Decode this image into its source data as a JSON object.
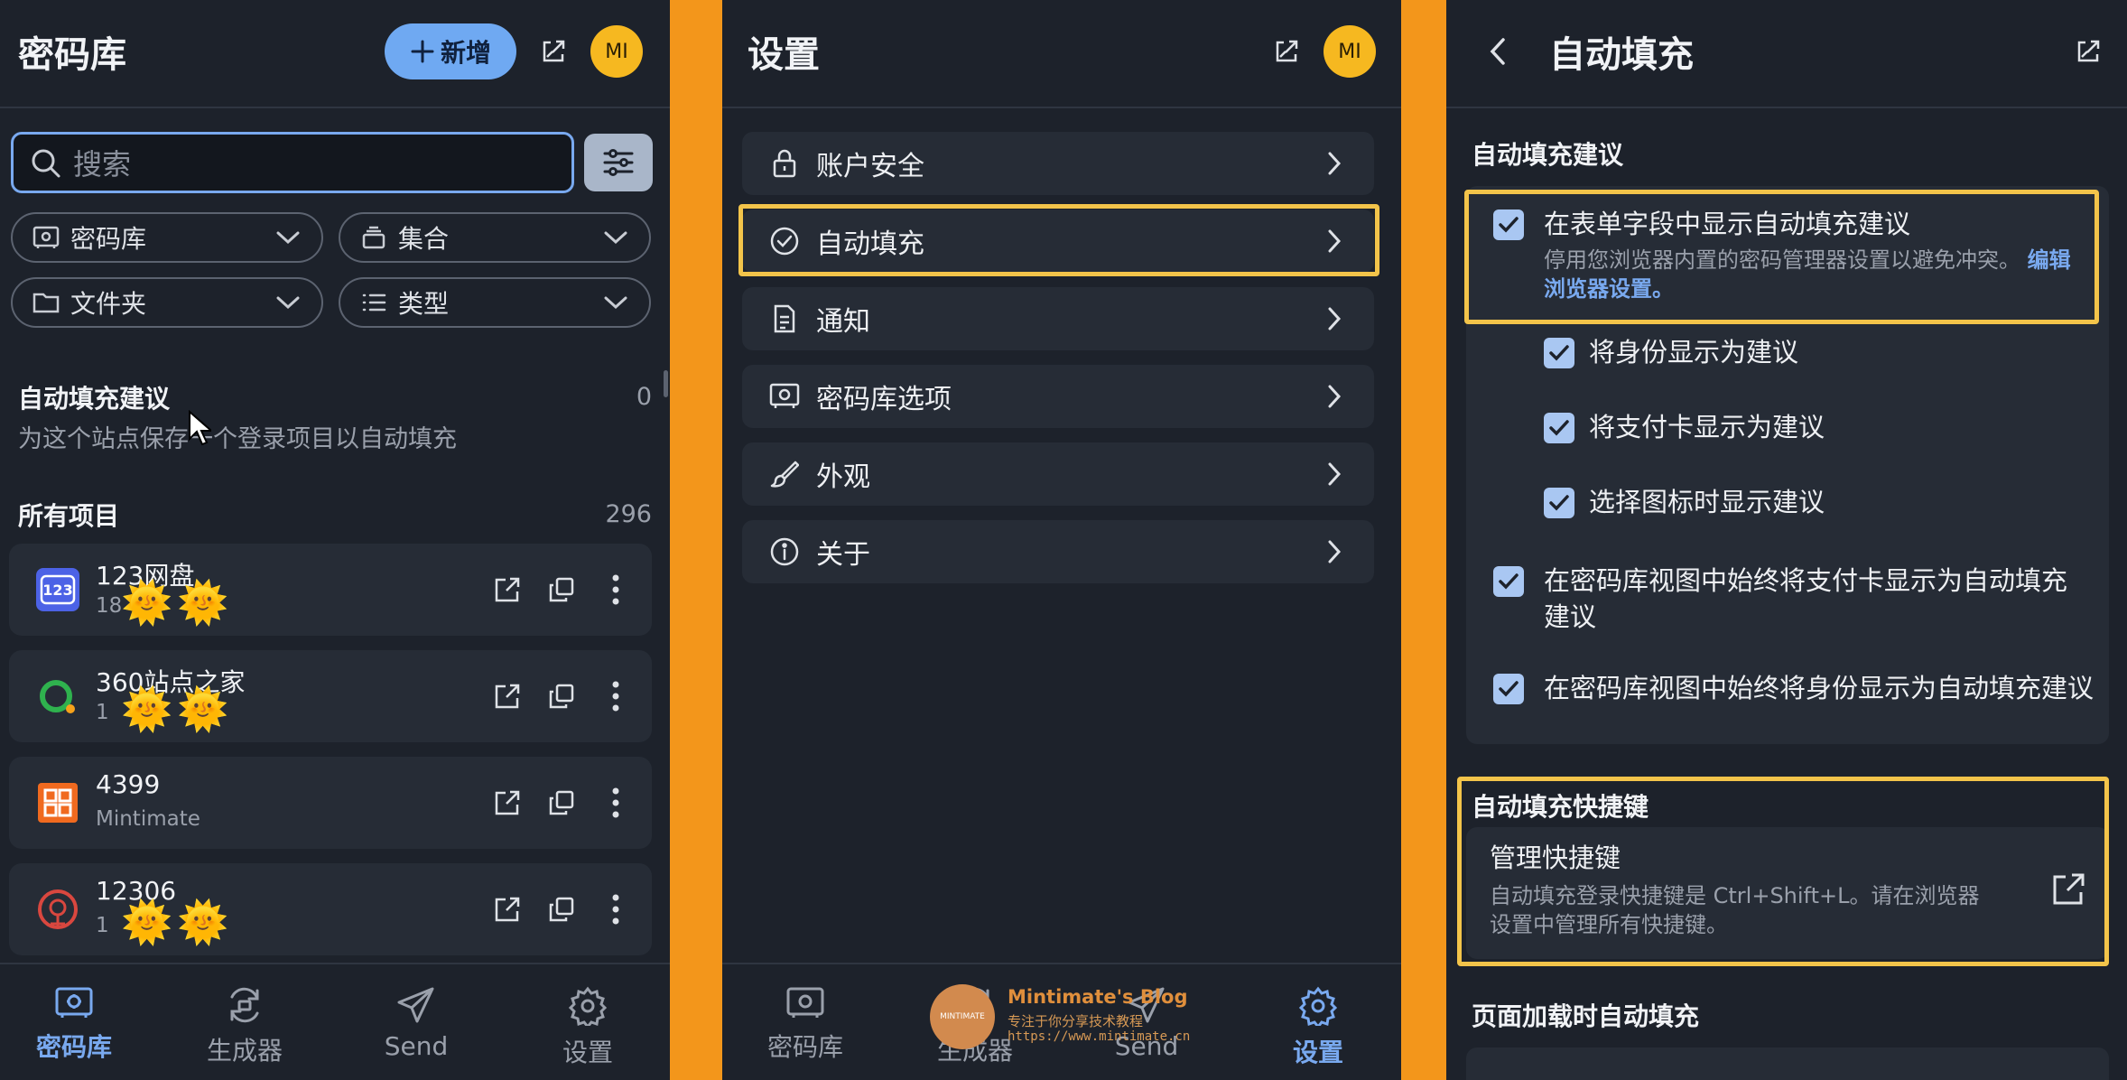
{
  "vault_panel": {
    "title": "密码库",
    "new_button": "新增",
    "avatar": "MI",
    "search_placeholder": "搜索",
    "filters": {
      "vault": "密码库",
      "collection": "集合",
      "folder": "文件夹",
      "type": "类型"
    },
    "autofill_section": {
      "title": "自动填充建议",
      "count": "0",
      "empty_text": "为这个站点保存一个登录项目以自动填充"
    },
    "all_items_section": {
      "title": "所有项目",
      "count": "296"
    },
    "items": [
      {
        "name": "123网盘",
        "subtitle": "18",
        "subtitle_tail": "3",
        "logo": "123pan-logo"
      },
      {
        "name": "360站点之家",
        "subtitle": "1",
        "subtitle_tail": "3",
        "logo": "360-logo"
      },
      {
        "name": "4399",
        "subtitle": "Mintimate",
        "subtitle_tail": "",
        "logo": "4399-logo"
      },
      {
        "name": "12306",
        "subtitle": "1",
        "subtitle_tail": "3",
        "logo": "12306-logo"
      }
    ],
    "redaction_emoji": "🌞",
    "nav": [
      {
        "label": "密码库",
        "icon": "vault-icon",
        "active": true
      },
      {
        "label": "生成器",
        "icon": "generator-icon",
        "active": false
      },
      {
        "label": "Send",
        "icon": "send-icon",
        "active": false
      },
      {
        "label": "设置",
        "icon": "settings-icon",
        "active": false
      }
    ]
  },
  "settings_panel": {
    "title": "设置",
    "avatar": "MI",
    "items": [
      {
        "label": "账户安全",
        "icon": "lock-icon"
      },
      {
        "label": "自动填充",
        "icon": "check-circle-icon",
        "highlighted": true
      },
      {
        "label": "通知",
        "icon": "document-icon"
      },
      {
        "label": "密码库选项",
        "icon": "vault-icon"
      },
      {
        "label": "外观",
        "icon": "brush-icon"
      },
      {
        "label": "关于",
        "icon": "info-icon"
      }
    ],
    "nav": [
      {
        "label": "密码库",
        "active": false
      },
      {
        "label": "生成器",
        "active": false
      },
      {
        "label": "Send",
        "active": false
      },
      {
        "label": "设置",
        "active": true
      }
    ],
    "watermark": {
      "title": "Mintimate's Blog",
      "subtitle": "专注于你分享技术教程",
      "url": "https://www.mintimate.cn",
      "logo_text": "MINTIMATE"
    }
  },
  "autofill_panel": {
    "title": "自动填充",
    "suggestions_heading": "自动填充建议",
    "main_option": {
      "label": "在表单字段中显示自动填充建议",
      "desc": "停用您浏览器内置的密码管理器设置以避免冲突。",
      "link": "编辑浏览器设置。",
      "checked": true
    },
    "sub_options": [
      {
        "label": "将身份显示为建议",
        "checked": true
      },
      {
        "label": "将支付卡显示为建议",
        "checked": true
      },
      {
        "label": "选择图标时显示建议",
        "checked": true
      }
    ],
    "vault_options": [
      {
        "label": "在密码库视图中始终将支付卡显示为自动填充建议",
        "checked": true
      },
      {
        "label": "在密码库视图中始终将身份显示为自动填充建议",
        "checked": true
      }
    ],
    "shortcut_heading": "自动填充快捷键",
    "shortcut": {
      "title": "管理快捷键",
      "desc": "自动填充登录快捷键是 Ctrl+Shift+L。请在浏览器设置中管理所有快捷键。"
    },
    "page_load_heading": "页面加载时自动填充"
  },
  "colors": {
    "accent": "#79a9ef",
    "highlight": "#f3c44a",
    "background": "#f3961b",
    "panel": "#1d222b"
  }
}
